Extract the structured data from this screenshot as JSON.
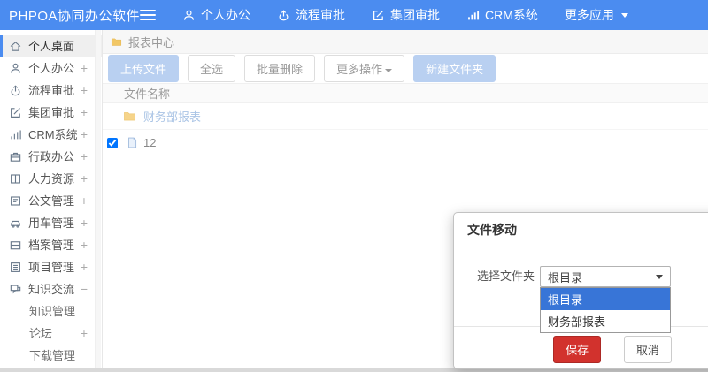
{
  "topbar": {
    "logo": "PHPOA协同办公软件",
    "nav": [
      {
        "label": "个人办公",
        "icon": "person-icon"
      },
      {
        "label": "流程审批",
        "icon": "approval-icon"
      },
      {
        "label": "集团审批",
        "icon": "edit-icon"
      },
      {
        "label": "CRM系统",
        "icon": "bar-chart-icon"
      },
      {
        "label": "更多应用",
        "icon": "caret-down-icon"
      }
    ]
  },
  "sidebar": {
    "items": [
      {
        "label": "个人桌面",
        "icon": "home-icon",
        "expander": "",
        "active": true
      },
      {
        "label": "个人办公",
        "icon": "person-icon",
        "expander": "+"
      },
      {
        "label": "流程审批",
        "icon": "approval-icon",
        "expander": "+"
      },
      {
        "label": "集团审批",
        "icon": "edit-icon",
        "expander": "+"
      },
      {
        "label": "CRM系统",
        "icon": "bar-chart-icon",
        "expander": "+"
      },
      {
        "label": "行政办公",
        "icon": "briefcase-icon",
        "expander": "+"
      },
      {
        "label": "人力资源",
        "icon": "book-icon",
        "expander": "+"
      },
      {
        "label": "公文管理",
        "icon": "document-icon",
        "expander": "+"
      },
      {
        "label": "用车管理",
        "icon": "car-icon",
        "expander": "+"
      },
      {
        "label": "档案管理",
        "icon": "archive-icon",
        "expander": "+"
      },
      {
        "label": "项目管理",
        "icon": "project-icon",
        "expander": "+"
      },
      {
        "label": "知识交流",
        "icon": "chat-icon",
        "expander": "−"
      }
    ],
    "subitems": [
      {
        "label": "知识管理",
        "expander": ""
      },
      {
        "label": "论坛",
        "expander": "+"
      },
      {
        "label": "下载管理",
        "expander": ""
      }
    ]
  },
  "breadcrumb": {
    "label": "报表中心",
    "icon": "folder-icon"
  },
  "toolbar": {
    "upload": "上传文件",
    "select_all": "全选",
    "batch_delete": "批量删除",
    "more_ops": "更多操作",
    "new_folder": "新建文件夹"
  },
  "filelist": {
    "header": "文件名称",
    "folder_row": {
      "label": "财务部报表",
      "icon": "folder-icon"
    },
    "file_row": {
      "label": "12",
      "icon": "file-icon",
      "checked": true
    }
  },
  "modal": {
    "title": "文件移动",
    "field_label": "选择文件夹",
    "selected_value": "根目录",
    "options": [
      "根目录",
      "财务部报表"
    ],
    "save_label": "保存",
    "cancel_label": "取消"
  },
  "colors": {
    "topbar_blue": "#4b8cf0",
    "pale_button_blue": "#b9d0f1",
    "option_highlight_blue": "#3875d7",
    "save_red": "#d2322d",
    "folder_yellow": "#f3c96b",
    "link_pale_blue": "#aac4e5"
  }
}
